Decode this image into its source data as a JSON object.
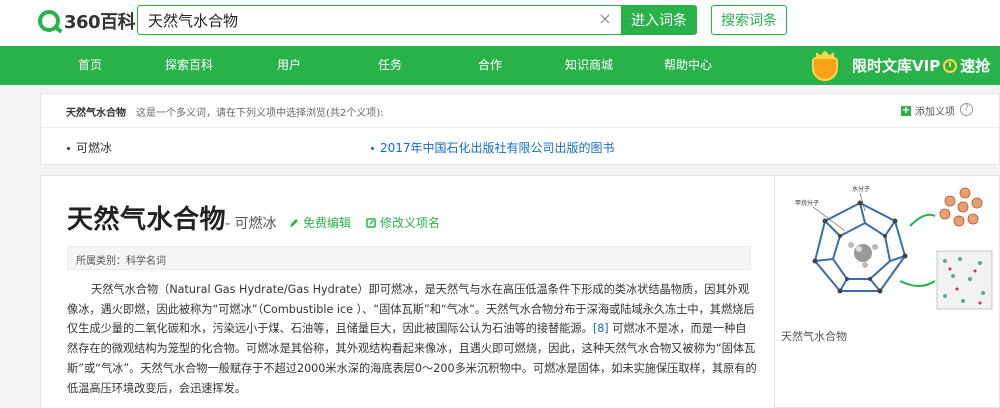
{
  "header": {
    "logo_text": "360百科",
    "search_value": "天然气水合物",
    "clear_glyph": "×",
    "enter_button": "进入词条",
    "search_button": "搜索词条"
  },
  "nav": {
    "items": [
      "首页",
      "探索百科",
      "用户",
      "任务",
      "合作",
      "知识商城",
      "帮助中心"
    ],
    "vip_text": "限时文库VIP",
    "vip_suffix": "速抢"
  },
  "disambiguation": {
    "title": "天然气水合物",
    "description": "这是一个多义词，请在下列义项中选择浏览(共2个义项):",
    "add_label": "添加义项",
    "help_glyph": "?",
    "items": [
      "可燃冰",
      "2017年中国石化出版社有限公司出版的图书"
    ]
  },
  "article": {
    "title": "天然气水合物",
    "subtitle": "- 可燃冰",
    "edit_label": "免费编辑",
    "modify_label": "修改义项名",
    "category": "所属类别：科学名词",
    "para_a": "天然气水合物（Natural Gas Hydrate/Gas Hydrate）即可燃冰，是天然气与水在高压低温条件下形成的类冰状结晶物质，因其外观像冰，遇火即燃，因此被称为“可燃冰”（Combustible ice ）、“固体瓦斯”和“气冰”。天然气水合物分布于深海或陆域永久冻土中，其燃烧后仅生成少量的二氧化碳和水，污染远小于煤、石油等，且储量巨大，因此被国际公认为石油等的接替能源。",
    "para_ref": "[8]",
    "para_b": " 可燃冰不是冰，而是一种自然存在的微观结构为笼型的化合物。可燃冰是其俗称，其外观结构看起来像冰，且遇火即可燃烧，因此，这种天然气水合物又被称为“固体瓦斯”或“气冰”。天然气水合物一般赋存于不超过2000米水深的海底表层0～200多米沉积物中。可燃冰是固体，如未实施保压取样，其原有的低温高压环境改变后，会迅速挥发。"
  },
  "side": {
    "label_molecule": "甲烷分子",
    "label_water": "水分子",
    "caption": "天然气水合物"
  },
  "colors": {
    "brand_green": "#2ab24a",
    "link_blue": "#136ec2"
  }
}
